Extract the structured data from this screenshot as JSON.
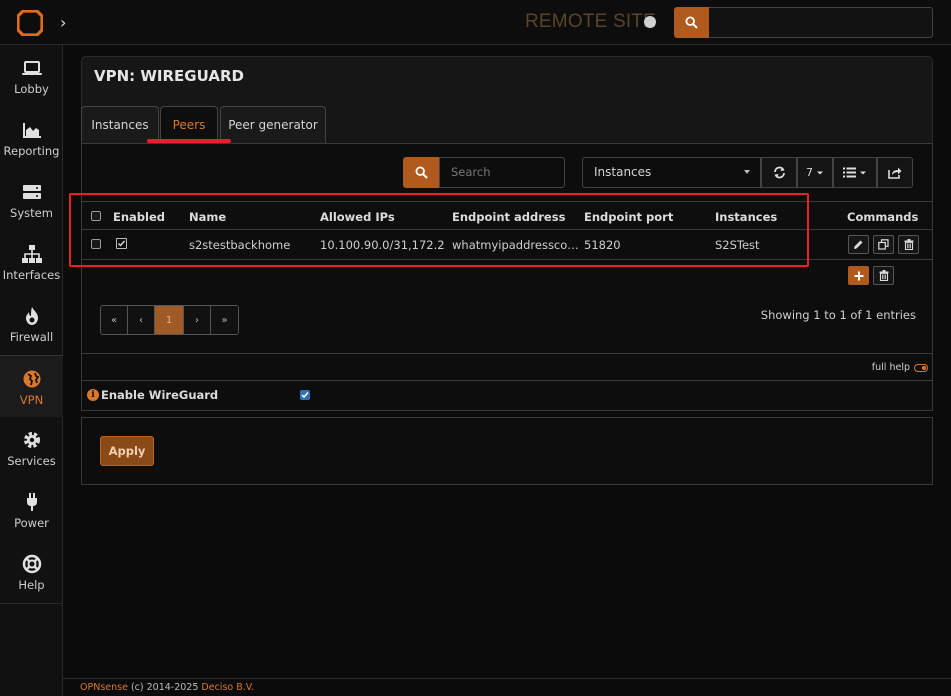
{
  "header": {
    "site_name": "REMOTE SITE",
    "expand_glyph": "›"
  },
  "sidebar": {
    "items": [
      {
        "label": "Lobby",
        "icon": "laptop-icon"
      },
      {
        "label": "Reporting",
        "icon": "area-chart-icon"
      },
      {
        "label": "System",
        "icon": "server-icon"
      },
      {
        "label": "Interfaces",
        "icon": "sitemap-icon"
      },
      {
        "label": "Firewall",
        "icon": "fire-icon"
      },
      {
        "label": "VPN",
        "icon": "globe-icon",
        "active": true
      },
      {
        "label": "Services",
        "icon": "cog-icon"
      },
      {
        "label": "Power",
        "icon": "plug-icon"
      },
      {
        "label": "Help",
        "icon": "lifebuoy-icon"
      }
    ]
  },
  "page": {
    "title": "VPN: WIREGUARD",
    "tabs": [
      {
        "label": "Instances"
      },
      {
        "label": "Peers",
        "active": true
      },
      {
        "label": "Peer generator"
      }
    ]
  },
  "toolbar": {
    "search_placeholder": "Search",
    "filter_value": "Instances",
    "page_size": "7"
  },
  "grid": {
    "columns": [
      "Enabled",
      "Name",
      "Allowed IPs",
      "Endpoint address",
      "Endpoint port",
      "Instances",
      "Commands"
    ],
    "rows": [
      {
        "enabled": true,
        "name": "s2stestbackhome",
        "allowed_ips": "10.100.90.0/31,172.2…",
        "endpoint_address": "whatmyipaddressco…",
        "endpoint_port": "51820",
        "instances": "S2STest"
      }
    ]
  },
  "pagination": {
    "first": "«",
    "prev": "‹",
    "current": "1",
    "next": "›",
    "last": "»",
    "showing": "Showing 1 to 1 of 1 entries"
  },
  "settings": {
    "full_help": "full help",
    "enable_label": "Enable WireGuard",
    "enable_checked": true,
    "info_glyph": "i"
  },
  "actions": {
    "apply_label": "Apply"
  },
  "footer": {
    "brand": "OPNsense",
    "middle": " (c) 2014-2025 ",
    "company": "Deciso B.V."
  },
  "colors": {
    "accent": "#d9772b",
    "button_orange": "#b05a1d",
    "highlight_red": "#e8202a",
    "checkbox_blue": "#2f6fb5"
  }
}
